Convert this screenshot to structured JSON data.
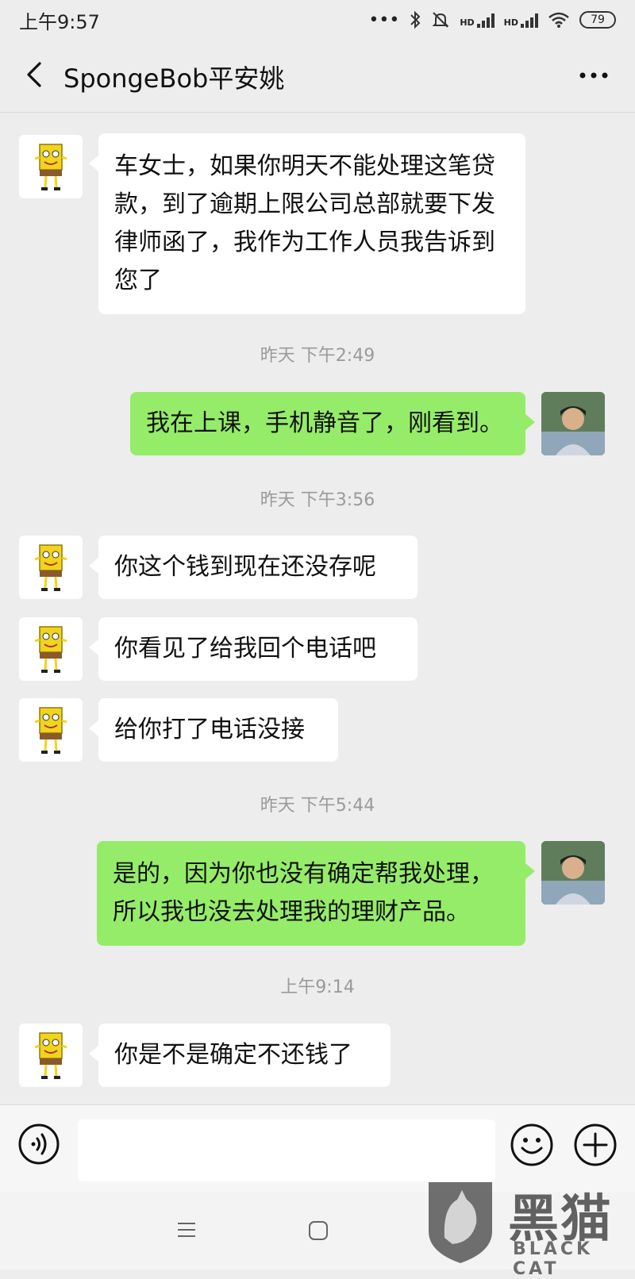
{
  "status_bar": {
    "time": "上午9:57",
    "dots": "•••",
    "hd1": "HD",
    "hd2": "HD",
    "battery": "79"
  },
  "header": {
    "title": "SpongeBob平安姚"
  },
  "messages": [
    {
      "type": "in",
      "text": "车女士，如果你明天不能处理这笔贷款，到了逾期上限公司总部就要下发律师函了，我作为工作人员我告诉到您了"
    },
    {
      "type": "time",
      "text": "昨天 下午2:49"
    },
    {
      "type": "out",
      "text": "我在上课，手机静音了，刚看到。"
    },
    {
      "type": "time",
      "text": "昨天 下午3:56"
    },
    {
      "type": "in",
      "text": "你这个钱到现在还没存呢"
    },
    {
      "type": "in",
      "text": "你看见了给我回个电话吧"
    },
    {
      "type": "in",
      "text": "给你打了电话没接"
    },
    {
      "type": "time",
      "text": "昨天 下午5:44"
    },
    {
      "type": "out",
      "text": "是的，因为你也没有确定帮我处理，所以我也没去处理我的理财产品。"
    },
    {
      "type": "time",
      "text": "上午9:14"
    },
    {
      "type": "in",
      "text": "你是不是确定不还钱了"
    }
  ],
  "input_bar": {
    "placeholder": "",
    "voice_icon": "voice-icon",
    "emoji_icon": "emoji-icon",
    "plus_icon": "plus-icon"
  },
  "watermark": {
    "cn": "黑猫",
    "en": "BLACK CAT"
  },
  "colors": {
    "background": "#ededed",
    "incoming_bubble": "#ffffff",
    "outgoing_bubble": "#95ec69",
    "timestamp": "#9a9a9a"
  }
}
